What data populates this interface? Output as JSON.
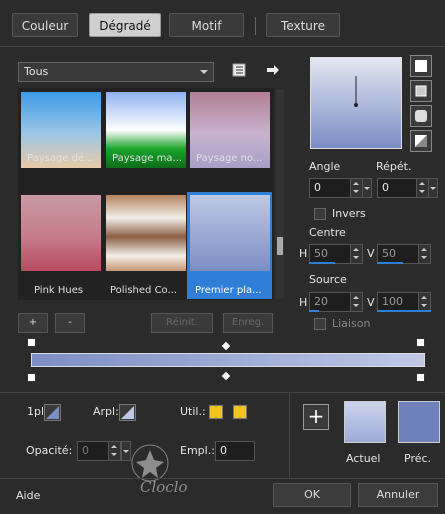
{
  "tabs": [
    {
      "label": "Couleur",
      "active": false
    },
    {
      "label": "Dégradé",
      "active": true
    },
    {
      "label": "Motif",
      "active": false
    },
    {
      "label": "Texture",
      "active": false
    }
  ],
  "gradient_list": {
    "dropdown_value": "Tous",
    "items": [
      {
        "label": "Paysage dé...",
        "colors": [
          "#3b9be8",
          "#e9c9a7"
        ]
      },
      {
        "label": "Paysage ma...",
        "colors": [
          "#8fb2f0",
          "#16a428"
        ]
      },
      {
        "label": "Paysage no...",
        "colors": [
          "#b07f94",
          "#a7a0c6"
        ]
      },
      {
        "label": "Pink Hues",
        "colors": [
          "#c99aa3",
          "#b8495e"
        ]
      },
      {
        "label": "Polished Co...",
        "colors": [
          "#b5825c",
          "#f2eee9"
        ]
      },
      {
        "label": "Premier pla...",
        "colors": [
          "#7a8ec4",
          "#bfc8e6"
        ],
        "selected": true
      }
    ]
  },
  "buttons": {
    "add": "+",
    "remove": "-",
    "reset": "Réinit.",
    "save": "Enreg.",
    "ok": "OK",
    "cancel": "Annuler",
    "help": "Aide",
    "plus": "+"
  },
  "angle": {
    "label": "Angle",
    "value": "0"
  },
  "repeat": {
    "label": "Répét.",
    "value": "0"
  },
  "invert": {
    "label": "Invers",
    "checked": false
  },
  "center": {
    "label": "Centre",
    "h_label": "H",
    "h_value": "50",
    "v_label": "V",
    "v_value": "50"
  },
  "source": {
    "label": "Source",
    "h_label": "H",
    "h_value": "20",
    "v_label": "V",
    "v_value": "100",
    "link_label": "Liaison",
    "link_checked": false
  },
  "bottom": {
    "opacity_label": "Opacité:",
    "opacity_value": "0",
    "location_label": "Empl.:",
    "location_value": "0",
    "one_pl_label": "1pl:",
    "arpl_label": "Arpl:",
    "util_label": "Util.:",
    "current_label": "Actuel",
    "previous_label": "Préc."
  },
  "colors": {
    "accent": "#2f7fd6",
    "gradient_start": "#7a8ec4",
    "gradient_end": "#bfc8e6",
    "current": "#b4c0e3",
    "previous": "#6f81bb",
    "util": "#f2c31f"
  },
  "watermark": "Cloclo",
  "icons": [
    "document-icon",
    "arrow-right-icon",
    "plus-icon",
    "color-swatch-icon"
  ]
}
